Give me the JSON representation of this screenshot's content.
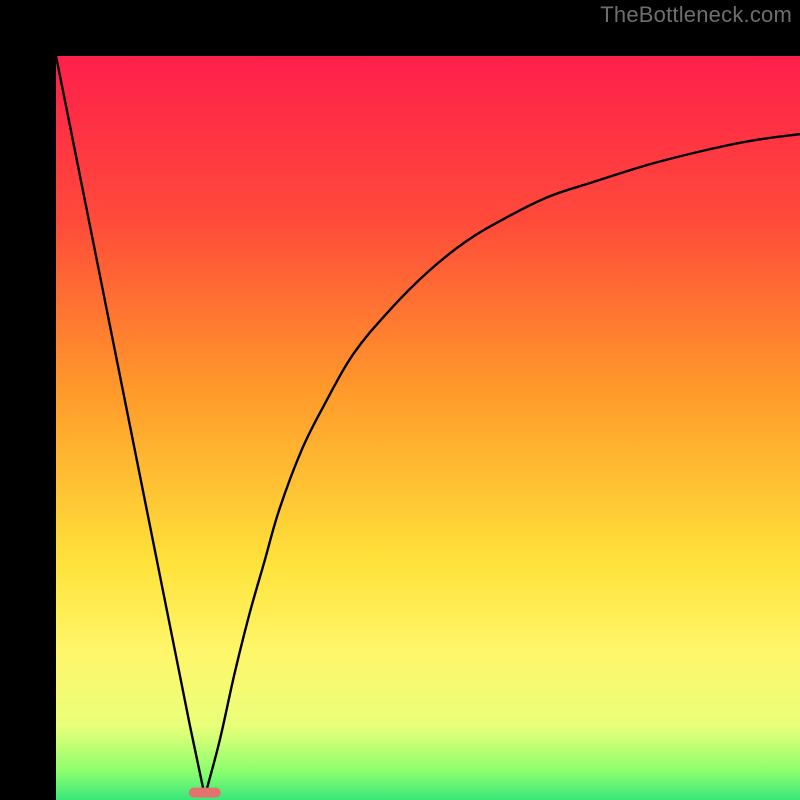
{
  "watermark": "TheBottleneck.com",
  "chart_data": {
    "type": "line",
    "title": "",
    "xlabel": "",
    "ylabel": "",
    "xlim": [
      0,
      100
    ],
    "ylim": [
      0,
      100
    ],
    "x_min_at": 20,
    "gradient_stops": [
      {
        "offset": 0.0,
        "color": "#ff1f4b"
      },
      {
        "offset": 0.22,
        "color": "#ff4a3a"
      },
      {
        "offset": 0.45,
        "color": "#ff9a2a"
      },
      {
        "offset": 0.68,
        "color": "#ffe23a"
      },
      {
        "offset": 0.8,
        "color": "#fff66a"
      },
      {
        "offset": 0.9,
        "color": "#eaff7a"
      },
      {
        "offset": 0.96,
        "color": "#8fff6e"
      },
      {
        "offset": 1.0,
        "color": "#38e87a"
      }
    ],
    "pill": {
      "cx": 20,
      "cy": 1.0,
      "color": "#e4736e"
    },
    "series": [
      {
        "name": "left-leg",
        "x": [
          0,
          2,
          4,
          6,
          8,
          10,
          12,
          14,
          16,
          18,
          20
        ],
        "y": [
          100,
          90,
          80,
          70,
          60,
          50,
          40,
          30,
          20,
          10,
          0.5
        ]
      },
      {
        "name": "right-curve",
        "x": [
          20,
          22,
          24,
          26,
          28,
          30,
          33,
          36,
          40,
          45,
          50,
          55,
          60,
          66,
          72,
          80,
          88,
          94,
          100
        ],
        "y": [
          0.5,
          8,
          17,
          25,
          32,
          39,
          47,
          53,
          60,
          66,
          71,
          75,
          78,
          81,
          83,
          85.5,
          87.5,
          88.7,
          89.5
        ]
      }
    ]
  }
}
